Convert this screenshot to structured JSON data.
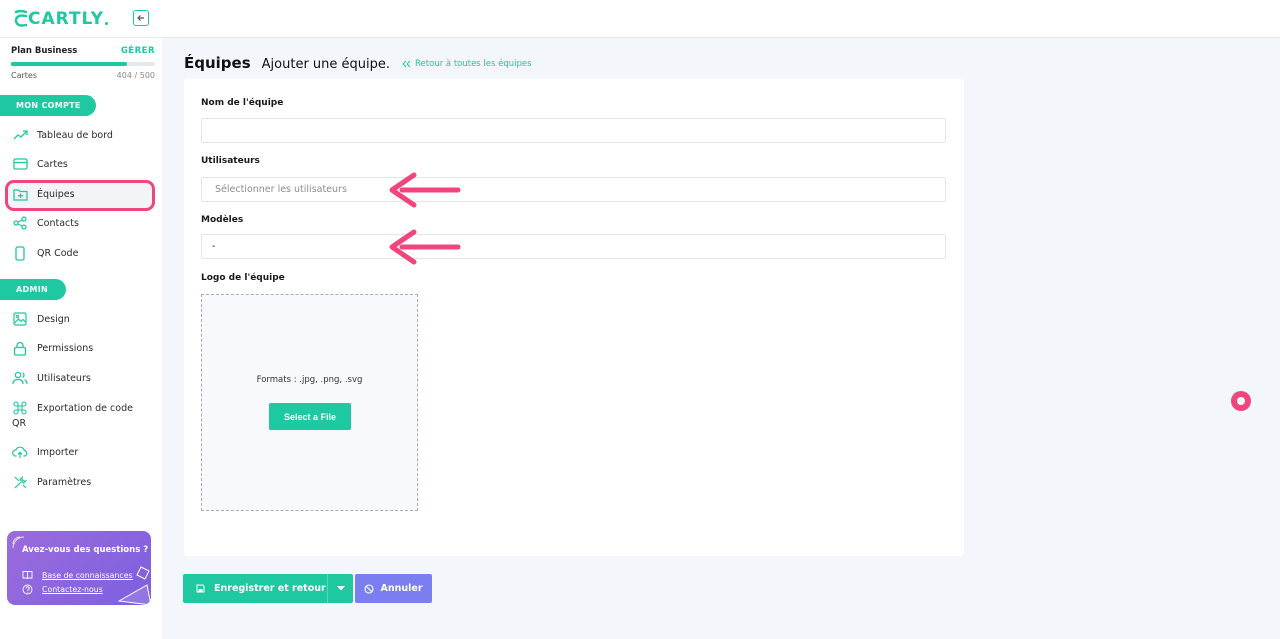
{
  "brand": {
    "name": "CARTLY",
    "accent": "#1ec8a0",
    "highlight": "#f0467c"
  },
  "plan": {
    "name": "Plan Business",
    "manage": "GÉRER",
    "cards_label": "Cartes",
    "cards_count": "404 / 500",
    "usage_fraction": 0.808
  },
  "sidebar": {
    "section_account": "MON COMPTE",
    "section_admin": "ADMIN",
    "account_items": [
      {
        "label": "Tableau de bord",
        "icon": "trend-icon"
      },
      {
        "label": "Cartes",
        "icon": "card-icon"
      },
      {
        "label": "Équipes",
        "icon": "folder-plus-icon"
      },
      {
        "label": "Contacts",
        "icon": "share-icon"
      },
      {
        "label": "QR Code",
        "icon": "phone-icon"
      }
    ],
    "admin_items": [
      {
        "label": "Design",
        "icon": "image-icon"
      },
      {
        "label": "Permissions",
        "icon": "lock-icon"
      },
      {
        "label": "Utilisateurs",
        "icon": "users-icon"
      },
      {
        "label": "Exportation de code QR",
        "icon": "command-icon"
      },
      {
        "label": "Importer",
        "icon": "upload-cloud-icon"
      },
      {
        "label": "Paramètres",
        "icon": "tools-icon"
      }
    ],
    "help": {
      "title": "Avez-vous des questions ?",
      "kb_link": "Base de connaissances",
      "contact_link": "Contactez-nous"
    }
  },
  "main": {
    "title": "Équipes",
    "subtitle": "Ajouter une équipe.",
    "back_link": "Retour à toutes les équipes",
    "fields": {
      "team_name_label": "Nom de l'équipe",
      "team_name_value": "",
      "users_label": "Utilisateurs",
      "users_placeholder": "Sélectionner les utilisateurs",
      "models_label": "Modèles",
      "models_value": "-",
      "logo_label": "Logo de l'équipe",
      "formats": "Formats : .jpg, .png, .svg",
      "select_file": "Select a File"
    },
    "actions": {
      "save": "Enregistrer et retour",
      "cancel": "Annuler"
    }
  }
}
